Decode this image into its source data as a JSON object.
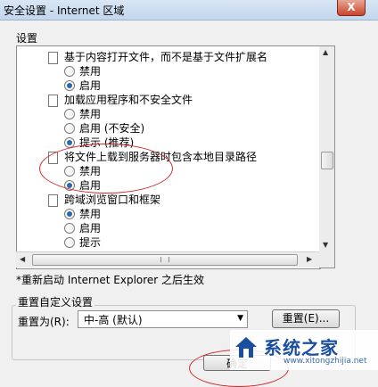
{
  "window": {
    "title": "安全设置 - Internet 区域",
    "close_label": "X"
  },
  "settings": {
    "group_label": "设置",
    "categories": [
      {
        "label": "基于内容打开文件，而不是基于文件扩展名",
        "options": [
          "禁用",
          "启用"
        ],
        "selected": 1
      },
      {
        "label": "加载应用程序和不安全文件",
        "options": [
          "禁用",
          "启用 (不安全)",
          "提示 (推荐)"
        ],
        "selected": 2
      },
      {
        "label": "将文件上载到服务器时包含本地目录路径",
        "options": [
          "禁用",
          "启用"
        ],
        "selected": 1
      },
      {
        "label": "跨域浏览窗口和框架",
        "options": [
          "禁用",
          "启用",
          "提示"
        ],
        "selected": 0
      }
    ]
  },
  "note": "*重新启动 Internet Explorer 之后生效",
  "reset_section": {
    "legend": "重置自定义设置",
    "label": "重置为(R):",
    "selected_value": "中-高 (默认)",
    "reset_button": "重置(E)..."
  },
  "ok_button": "确定",
  "watermark": {
    "brand": "系统之家",
    "url": "www.xitongzhijia.net"
  },
  "colors": {
    "titlebar": "#c3d6ec",
    "annotation": "#d02a2a",
    "brand": "#1a4fa0"
  }
}
